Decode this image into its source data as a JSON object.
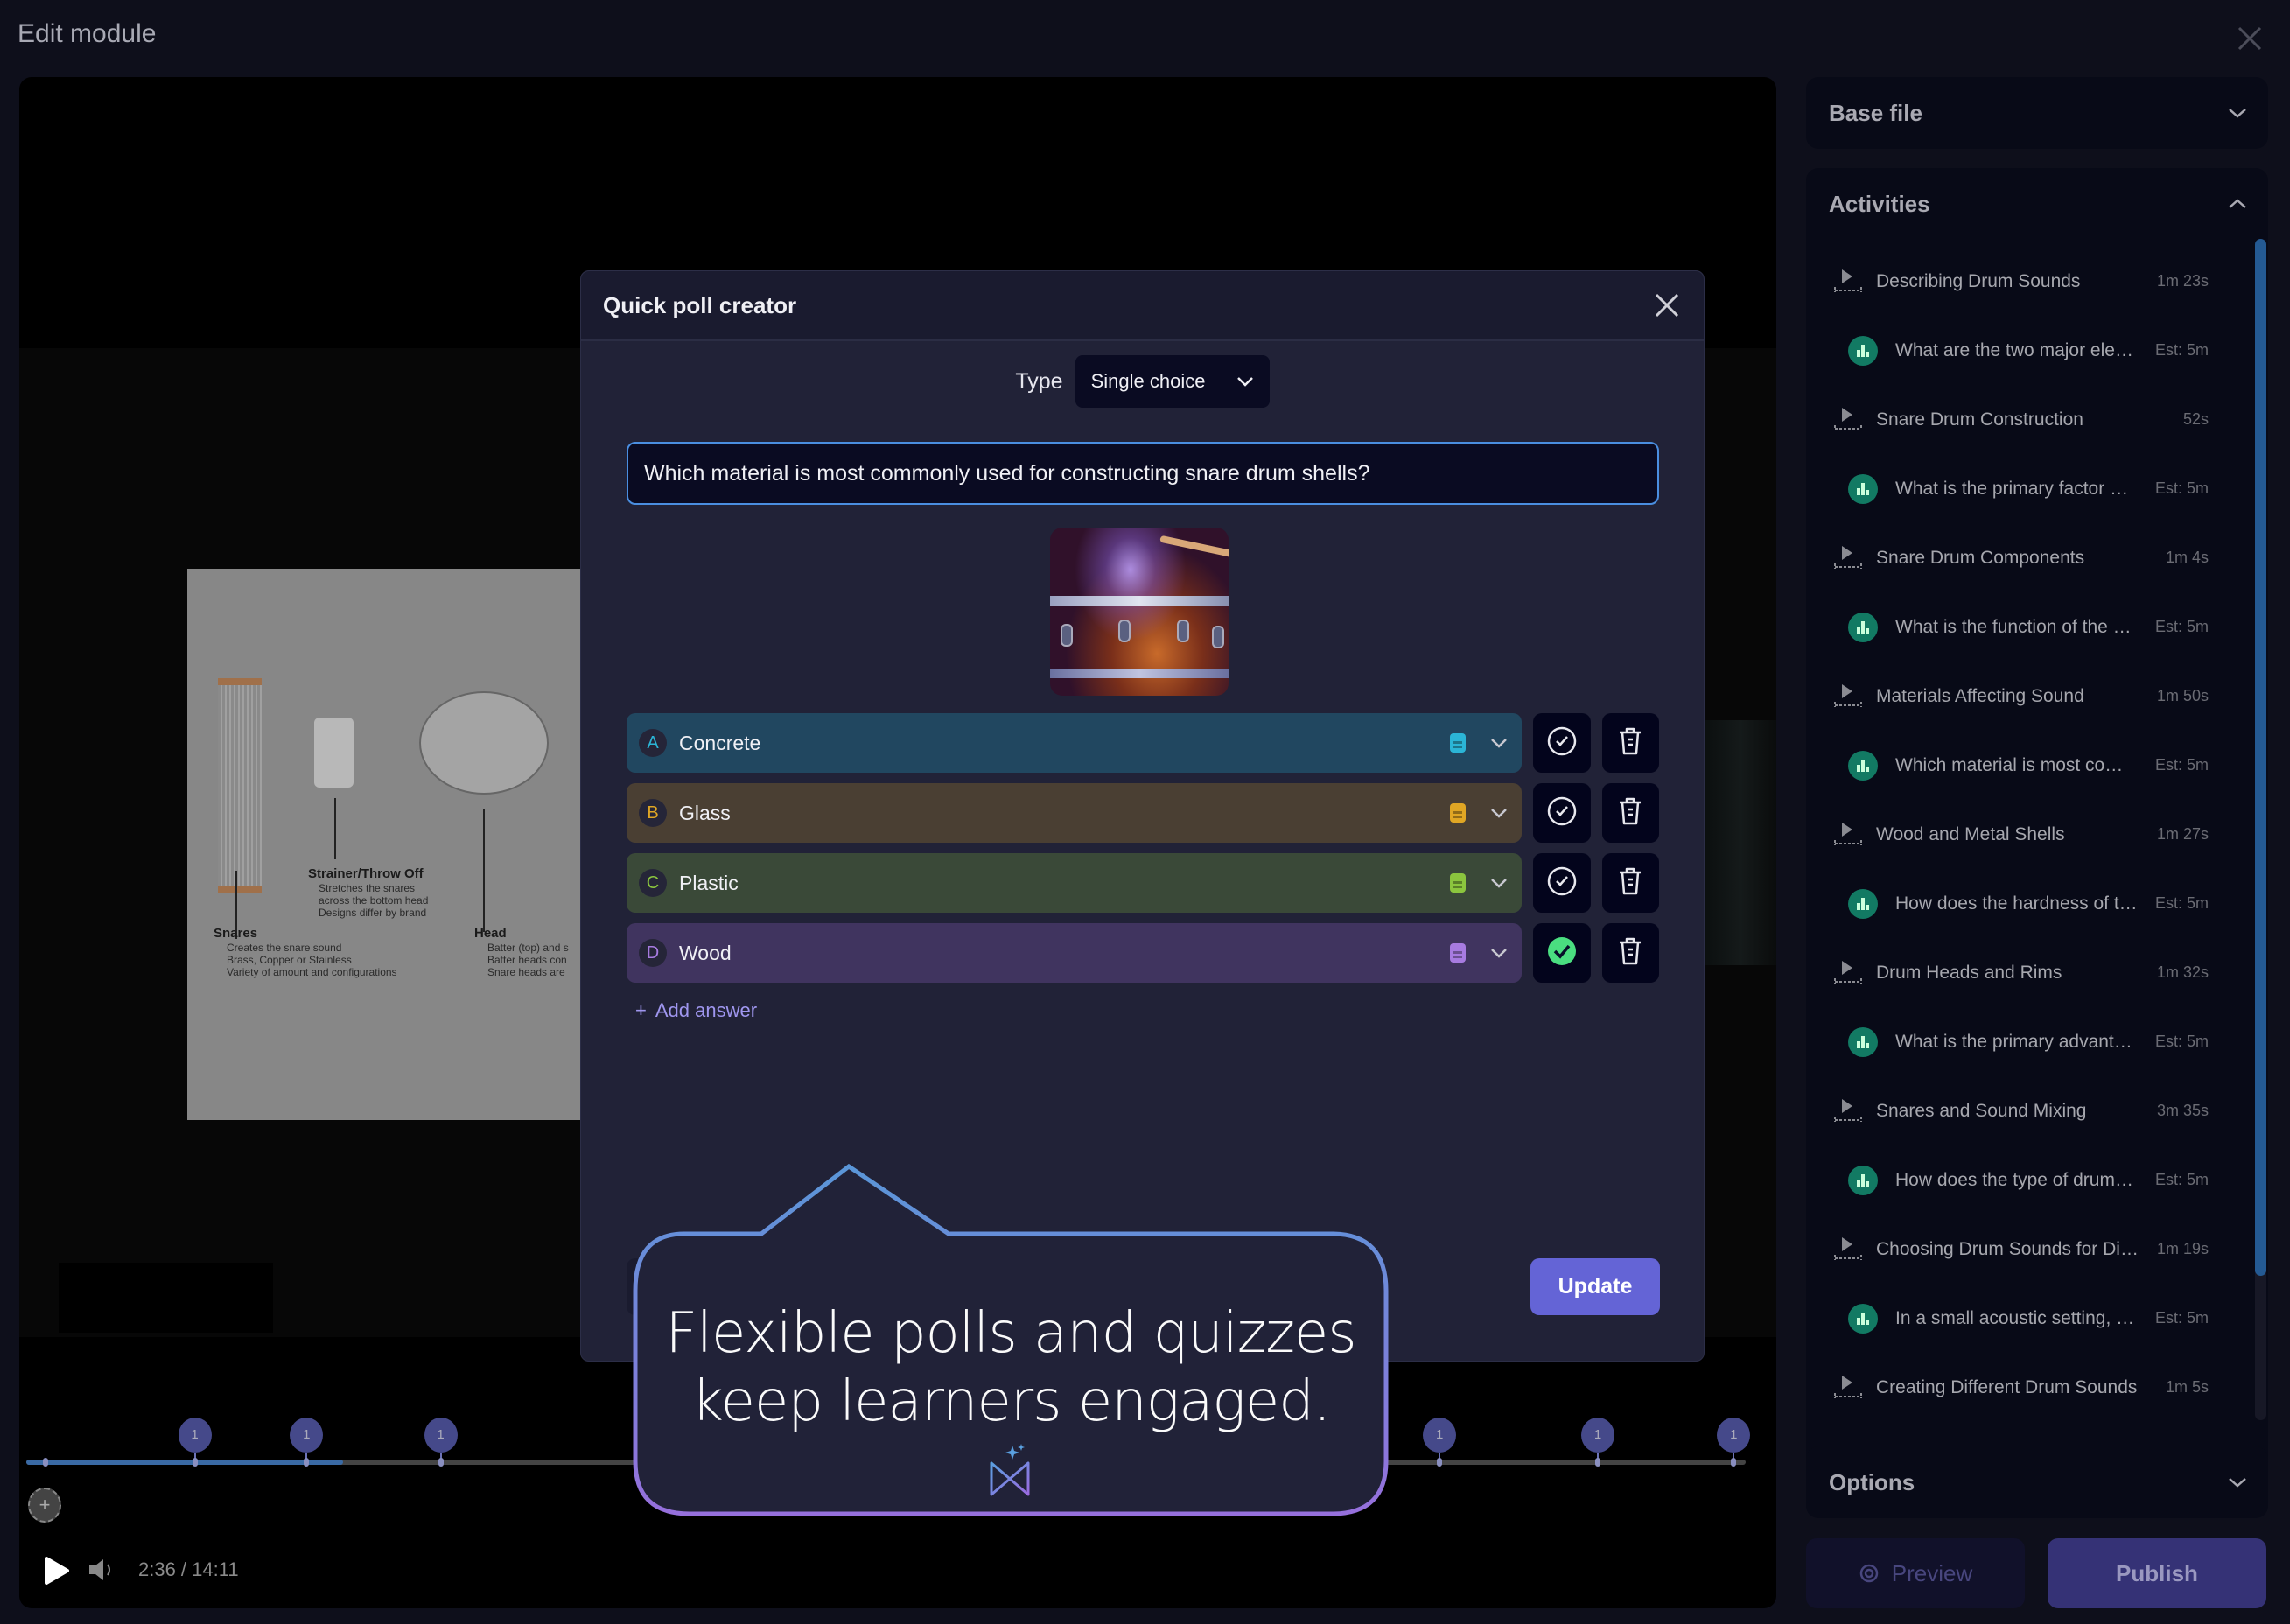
{
  "app": {
    "title": "Edit module",
    "close_icon": "close-icon"
  },
  "video": {
    "time_current": "2:36",
    "time_total": "14:11",
    "time_readout": "2:36 / 14:11",
    "progress_fraction": 0.184,
    "markers": [
      {
        "label": "1",
        "time_fraction": 0.098
      },
      {
        "label": "1",
        "time_fraction": 0.163
      },
      {
        "label": "1",
        "time_fraction": 0.241
      },
      {
        "label": "1",
        "time_fraction": 0.369
      },
      {
        "label": "1",
        "time_fraction": 0.472
      },
      {
        "label": "1",
        "time_fraction": 0.579
      },
      {
        "label": "1",
        "time_fraction": 0.822
      },
      {
        "label": "1",
        "time_fraction": 0.914
      },
      {
        "label": "1",
        "time_fraction": 0.993
      }
    ],
    "add_marker_label": "+",
    "slide": {
      "snares_title": "Snares",
      "snares_points": [
        "Creates the snare sound",
        "Brass, Copper or Stainless",
        "Variety of amount and configurations"
      ],
      "strainer_title": "Strainer/Throw Off",
      "strainer_points": [
        "Stretches the snares",
        "across the bottom head",
        "Designs differ by brand"
      ],
      "head_title": "Head",
      "head_points": [
        "Batter (top) and s",
        "Batter heads con",
        "Snare heads are"
      ]
    }
  },
  "dialog": {
    "title": "Quick poll creator",
    "type_label": "Type",
    "type_value": "Single choice",
    "question": "Which material is most commonly used for constructing snare drum shells?",
    "image_alt": "Snare drum with purple powder burst",
    "answers": [
      {
        "letter": "A",
        "text": "Concrete",
        "bg": "#214760",
        "accent": "#2bb5d6",
        "correct": false
      },
      {
        "letter": "B",
        "text": "Glass",
        "bg": "#4a3f33",
        "accent": "#e0a624",
        "correct": false
      },
      {
        "letter": "C",
        "text": "Plastic",
        "bg": "#3a4938",
        "accent": "#8bc53e",
        "correct": false
      },
      {
        "letter": "D",
        "text": "Wood",
        "bg": "#40345f",
        "accent": "#a77be0",
        "correct": true
      }
    ],
    "add_answer_label": "Add answer",
    "update_label": "Update"
  },
  "callout": {
    "line1": "Flexible polls and quizzes",
    "line2": "keep learners engaged."
  },
  "sidebar": {
    "base_file_label": "Base file",
    "activities_label": "Activities",
    "options_label": "Options",
    "activities": [
      {
        "kind": "video",
        "title": "Describing Drum Sounds",
        "duration": "1m 23s"
      },
      {
        "kind": "poll",
        "title": "What are the two major ele…",
        "duration": "Est: 5m"
      },
      {
        "kind": "video",
        "title": "Snare Drum Construction",
        "duration": "52s"
      },
      {
        "kind": "poll",
        "title": "What is the primary factor …",
        "duration": "Est: 5m"
      },
      {
        "kind": "video",
        "title": "Snare Drum Components",
        "duration": "1m 4s"
      },
      {
        "kind": "poll",
        "title": "What is the function of the …",
        "duration": "Est: 5m"
      },
      {
        "kind": "video",
        "title": "Materials Affecting Sound",
        "duration": "1m 50s"
      },
      {
        "kind": "poll",
        "title": "Which material is most co…",
        "duration": "Est: 5m"
      },
      {
        "kind": "video",
        "title": "Wood and Metal Shells",
        "duration": "1m 27s"
      },
      {
        "kind": "poll",
        "title": "How does the hardness of t…",
        "duration": "Est: 5m"
      },
      {
        "kind": "video",
        "title": "Drum Heads and Rims",
        "duration": "1m 32s"
      },
      {
        "kind": "poll",
        "title": "What is the primary advant…",
        "duration": "Est: 5m"
      },
      {
        "kind": "video",
        "title": "Snares and Sound Mixing",
        "duration": "3m 35s"
      },
      {
        "kind": "poll",
        "title": "How does the type of drum…",
        "duration": "Est: 5m"
      },
      {
        "kind": "video",
        "title": "Choosing Drum Sounds for Di…",
        "duration": "1m 19s"
      },
      {
        "kind": "poll",
        "title": "In a small acoustic setting, …",
        "duration": "Est: 5m"
      },
      {
        "kind": "video",
        "title": "Creating Different Drum Sounds",
        "duration": "1m 5s"
      }
    ],
    "scroll_fraction": 0.0,
    "preview_label": "Preview",
    "publish_label": "Publish"
  },
  "colors": {
    "accent": "#6464d6",
    "correct": "#4ade80",
    "poll_icon": "#127a63",
    "question_border": "#4a8ee0"
  }
}
